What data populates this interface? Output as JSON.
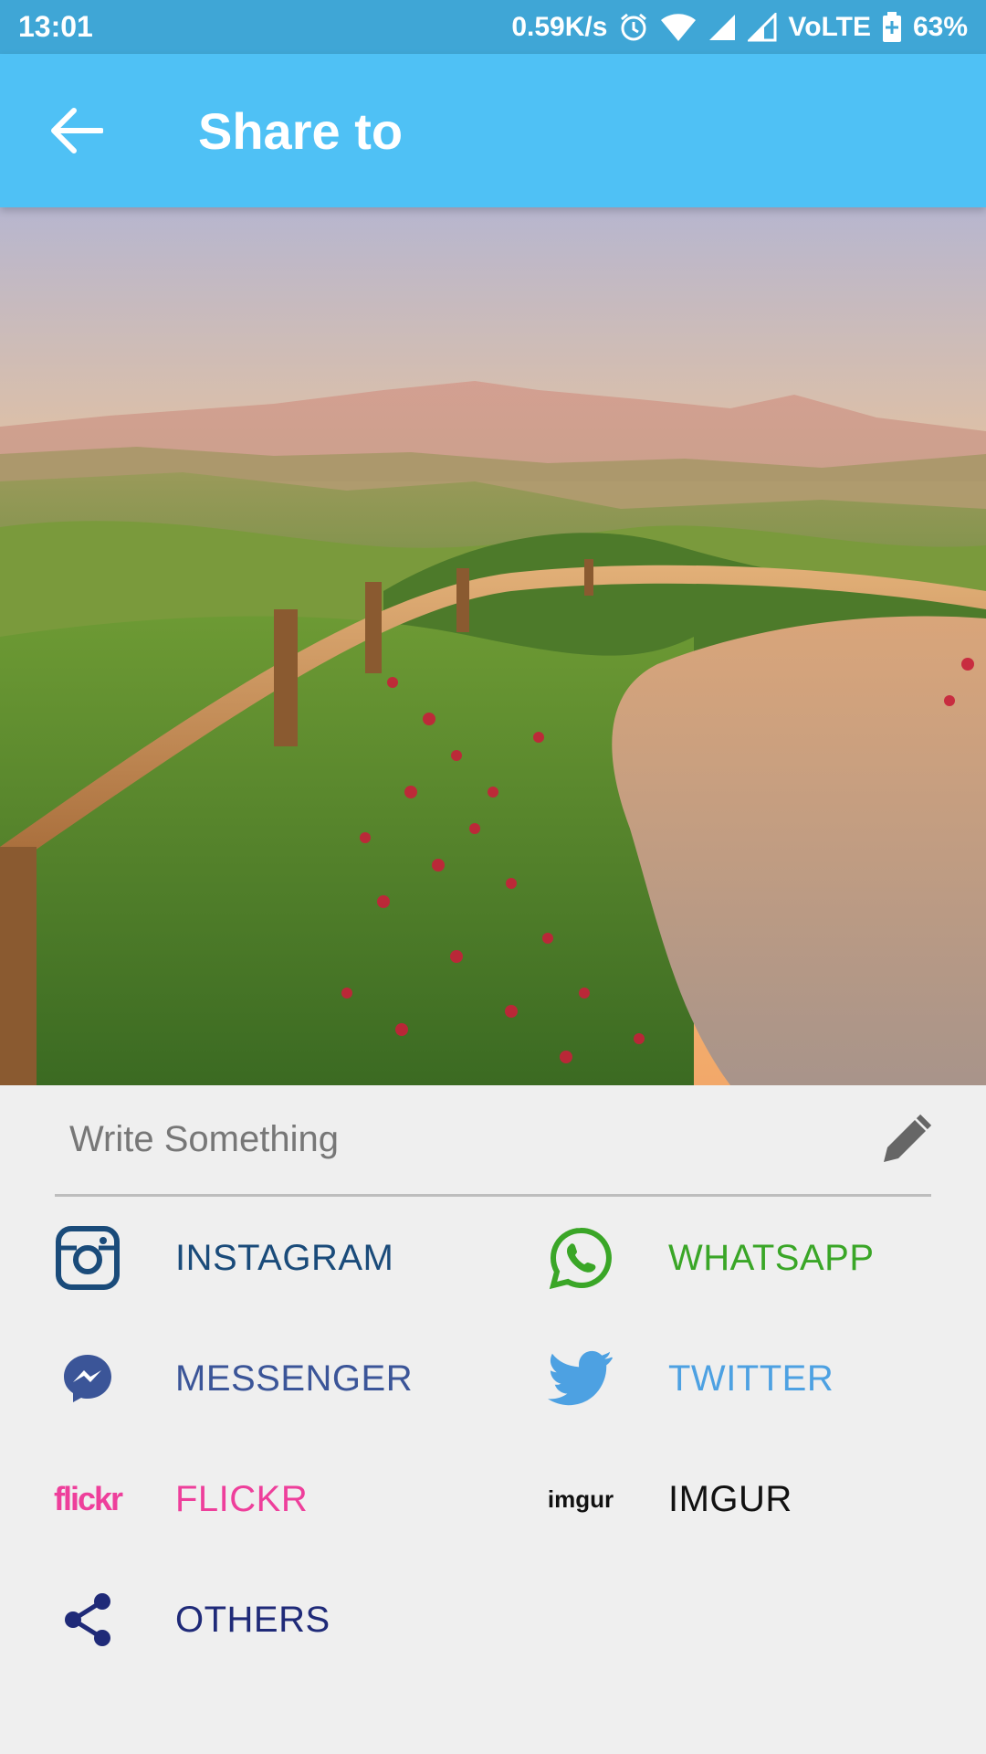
{
  "status_bar": {
    "time": "13:01",
    "net_speed": "0.59K/s",
    "network_label": "VoLTE",
    "battery": "63%"
  },
  "app_bar": {
    "title": "Share to",
    "back_icon": "arrow-left-icon"
  },
  "caption": {
    "placeholder": "Write Something",
    "value": "",
    "edit_icon": "pencil-icon"
  },
  "share_targets": [
    {
      "label": "INSTAGRAM",
      "icon": "instagram-icon",
      "color": "#1a4b7a"
    },
    {
      "label": "WHATSAPP",
      "icon": "whatsapp-icon",
      "color": "#3aa627"
    },
    {
      "label": "MESSENGER",
      "icon": "messenger-icon",
      "color": "#3b5598"
    },
    {
      "label": "TWITTER",
      "icon": "twitter-icon",
      "color": "#4da1e2"
    },
    {
      "label": "FLICKR",
      "icon": "flickr-icon",
      "logo_text": "flickr",
      "color": "#ee3f9b"
    },
    {
      "label": "IMGUR",
      "icon": "imgur-icon",
      "logo_text": "imgur",
      "color": "#111111"
    },
    {
      "label": "OTHERS",
      "icon": "share-icon",
      "color": "#1f2a78"
    }
  ],
  "colors": {
    "app_bar": "#4fc1f5",
    "status_bar": "#3fa6d6",
    "background": "#efefef"
  }
}
